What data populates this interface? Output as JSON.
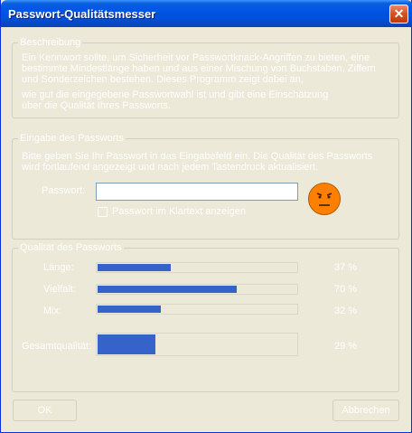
{
  "window": {
    "title": "Passwort-Qualitätsmesser",
    "close_glyph": "✕"
  },
  "description": {
    "legend": "Beschreibung",
    "lines": [
      "Ein Kennwort sollte, um Sicherheit vor Passwortknack-Angriffen zu bieten, eine",
      "bestimmte Mindestlänge haben und aus einer Mischung von Buchstaben, Ziffern",
      "und Sonderzeichen bestehen. Dieses Programm zeigt dabei an,",
      "wie gut die eingegebene Passwortwahl ist und gibt eine Einschätzung",
      "über die Qualität Ihres Passworts."
    ]
  },
  "password_input": {
    "legend": "Eingabe des Passworts",
    "lines": [
      "Bitte geben Sie Ihr Passwort in das Eingabefeld ein. Die Qualität des Passworts",
      "wird fortlaufend angezeigt und nach jedem Tastendruck aktualisiert."
    ],
    "field_label": "Passwort:",
    "value": "",
    "checkbox_label": "Passwort im Klartext anzeigen",
    "checkbox_checked": false,
    "quality_face": "unhappy"
  },
  "quality": {
    "legend": "Qualität des Passworts",
    "bars": [
      {
        "label": "Länge:",
        "fraction": 0.37,
        "value_text": "37 %"
      },
      {
        "label": "Vielfalt:",
        "fraction": 0.7,
        "value_text": "70 %"
      },
      {
        "label": "Mix:",
        "fraction": 0.32,
        "value_text": "32 %"
      }
    ],
    "overall": {
      "label": "Gesamtqualität:",
      "fraction": 0.29,
      "value_text": "29 %"
    }
  },
  "buttons": {
    "ok": "OK",
    "cancel": "Abbrechen"
  },
  "colors": {
    "bar_fill": "#3563c9",
    "face": "#ff8000",
    "title_bar": "#0055e5"
  }
}
